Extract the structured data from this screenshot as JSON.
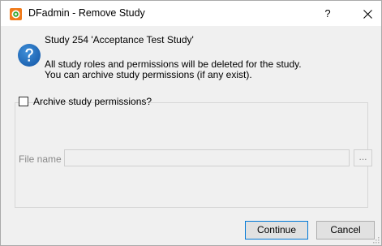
{
  "window": {
    "title": "DFadmin - Remove Study",
    "help_label": "?",
    "icons": {
      "app": "dfadmin-app-icon",
      "close": "close-icon",
      "question": "question-icon"
    }
  },
  "dialog": {
    "study_title": "Study 254 'Acceptance Test Study'",
    "message_line1": "All study roles and permissions will be deleted for the study.",
    "message_line2": "You can archive study permissions (if any exist).",
    "archive_checkbox_label": "Archive study permissions?",
    "archive_checked": false,
    "file_name_label": "File name",
    "file_name_value": "",
    "browse_label": "..."
  },
  "buttons": {
    "continue_label": "Continue",
    "cancel_label": "Cancel"
  },
  "colors": {
    "accent": "#0078d7",
    "question_icon": "#1e72c0",
    "app_icon_orange": "#f07a1a",
    "app_icon_green": "#3aa935"
  }
}
